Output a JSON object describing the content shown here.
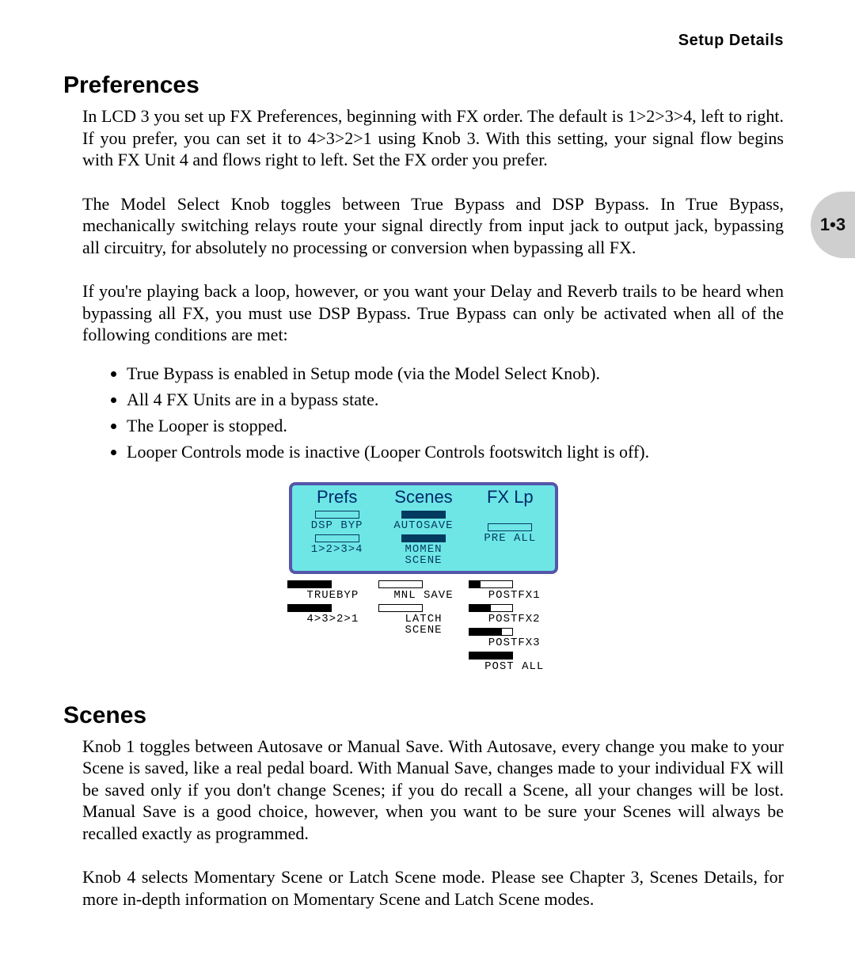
{
  "header": "Setup  Details",
  "page_tab": "1•3",
  "sections": {
    "prefs": {
      "title": "Preferences",
      "p1": "In LCD 3 you set up FX Preferences, beginning with FX order.  The default is 1>2>3>4, left to right.  If you prefer, you can set it to 4>3>2>1 using Knob 3. With this setting, your signal flow begins with FX Unit 4 and flows right to left.  Set the FX order you prefer.",
      "p2": "The Model Select Knob toggles between True Bypass and DSP Bypass.  In True Bypass, mechanically switching relays route your signal directly from input jack to output jack, bypassing all circuitry, for absolutely no processing or conversion when bypassing all FX.",
      "p3": "If you're playing back a loop, however, or you want your Delay and Reverb trails to be heard when bypassing all FX, you must use DSP Bypass.  True Bypass can only be activated when all of the following conditions are met:",
      "bullets": [
        "True Bypass is enabled in Setup mode (via the Model Select Knob).",
        "All 4 FX Units are in a bypass state.",
        "The Looper is stopped.",
        "Looper Controls mode is inactive (Looper Controls footswitch light is off)."
      ]
    },
    "scenes": {
      "title": "Scenes",
      "p1": "Knob 1 toggles between Autosave or Manual Save.  With Autosave, every change you make to your Scene is saved, like a real pedal board.  With Manual Save, changes made to your individual FX will be saved only if you don't change Scenes; if you do recall a Scene, all your changes will be lost.  Manual Save is a good choice, however, when you want to be sure your Scenes will always be recalled exactly as programmed.",
      "p2": "Knob 4 selects Momentary Scene or Latch Scene mode.  Please see Chapter 3, Scenes Details, for more in-depth information on Momentary Scene and Latch Scene modes."
    }
  },
  "lcd": {
    "cols": [
      {
        "title": "Prefs",
        "screen": [
          {
            "fill": 0.0,
            "label": "DSP BYP"
          },
          {
            "fill": 0.0,
            "label": "1>2>3>4"
          }
        ],
        "below": [
          {
            "fill": 1.0,
            "label": "TRUEBYP"
          },
          {
            "fill": 1.0,
            "label": "4>3>2>1"
          }
        ]
      },
      {
        "title": "Scenes",
        "screen": [
          {
            "fill": 1.0,
            "label": "AUTOSAVE"
          },
          {
            "fill": 1.0,
            "label": "MOMEN\nSCENE"
          }
        ],
        "below": [
          {
            "fill": 0.0,
            "label": "MNL SAVE"
          },
          {
            "fill": 0.0,
            "label": "LATCH\nSCENE"
          }
        ]
      },
      {
        "title": "FX Lp",
        "screen": [
          {
            "fill": null,
            "label": ""
          },
          {
            "fill": 0.0,
            "label": "PRE ALL"
          }
        ],
        "below": [
          {
            "fill": 0.25,
            "label": "POSTFX1"
          },
          {
            "fill": 0.5,
            "label": "POSTFX2"
          },
          {
            "fill": 0.75,
            "label": "POSTFX3"
          },
          {
            "fill": 1.0,
            "label": "POST ALL"
          }
        ]
      }
    ]
  }
}
